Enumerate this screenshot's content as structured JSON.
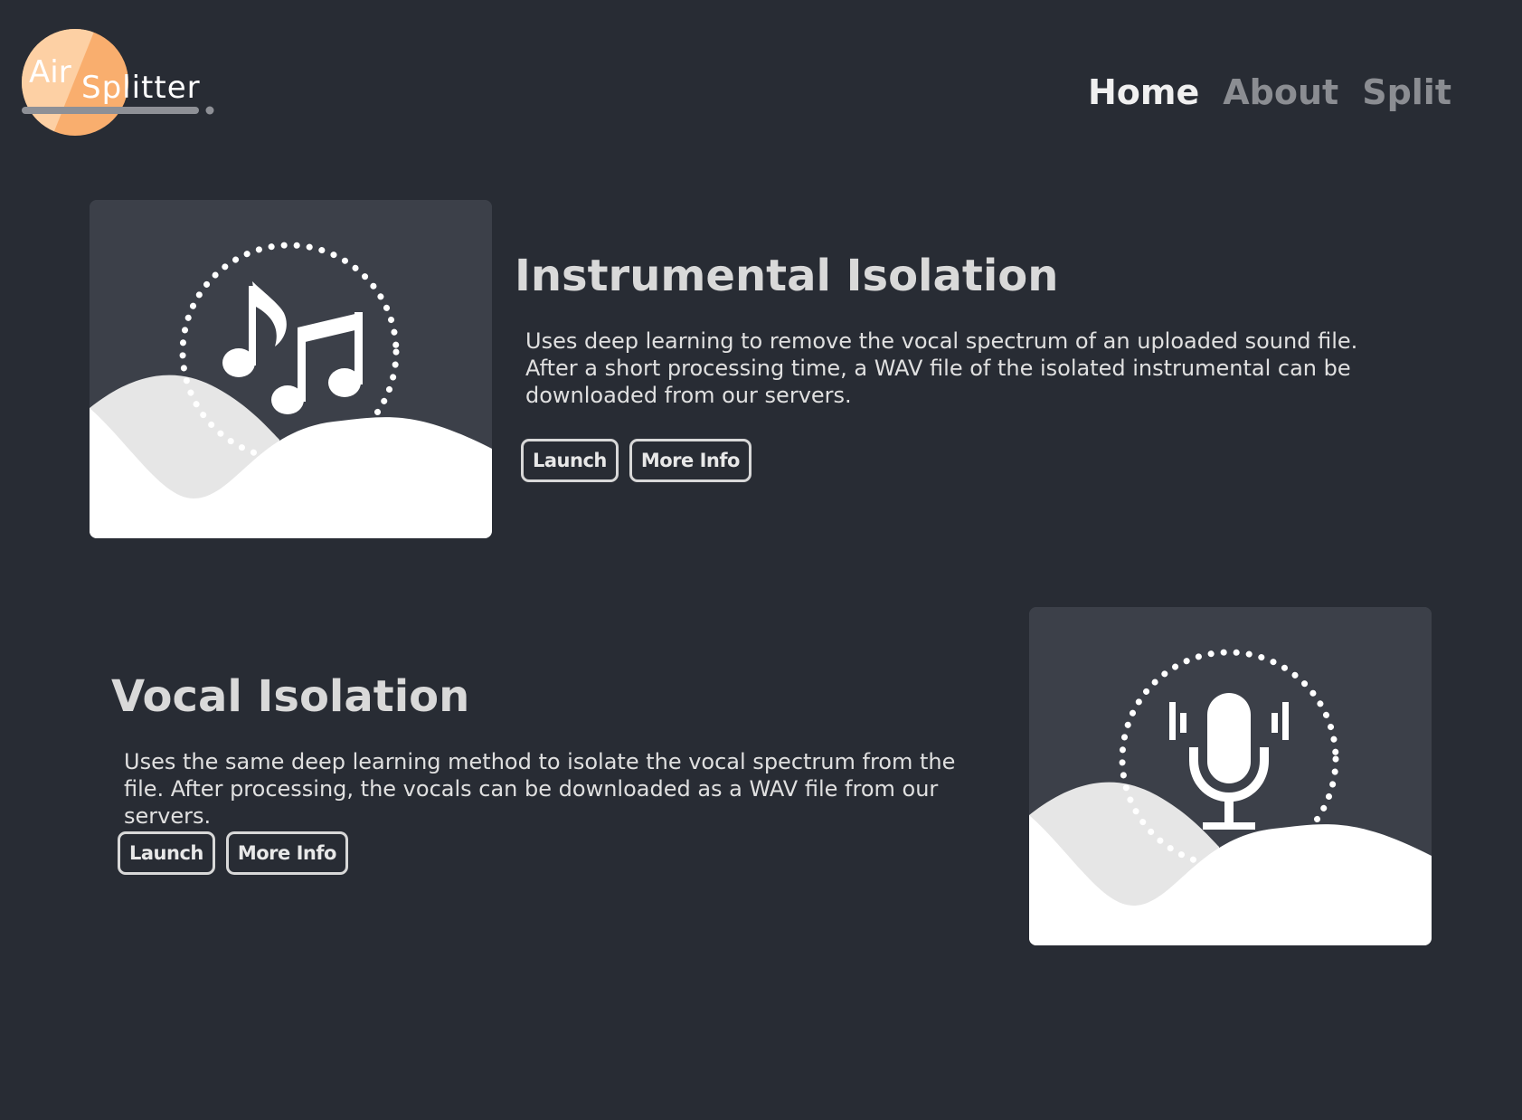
{
  "logo": {
    "part1": "Air",
    "part2": "Splitter",
    "colors": {
      "circle": "#f9ae6e",
      "circle_light": "#fdd0a4"
    }
  },
  "nav": {
    "items": [
      {
        "label": "Home",
        "active": true
      },
      {
        "label": "About",
        "active": false
      },
      {
        "label": "Split",
        "active": false
      }
    ]
  },
  "features": [
    {
      "title": "Instrumental Isolation",
      "description": "Uses deep learning to remove the vocal spectrum of an uploaded sound file. After a short processing time, a WAV file of the isolated instrumental can be downloaded from our servers.",
      "icon": "music-notes-icon",
      "buttons": {
        "launch": "Launch",
        "more_info": "More Info"
      }
    },
    {
      "title": "Vocal Isolation",
      "description": "Uses the same deep learning method to isolate the vocal spectrum from the file. After processing, the vocals can be downloaded as a WAV file from our servers.",
      "icon": "microphone-icon",
      "buttons": {
        "launch": "Launch",
        "more_info": "More Info"
      }
    }
  ],
  "colors": {
    "background": "#282c34",
    "card": "#3c4049",
    "wave": "#ffffff",
    "wave_back": "#e6e6e6"
  }
}
